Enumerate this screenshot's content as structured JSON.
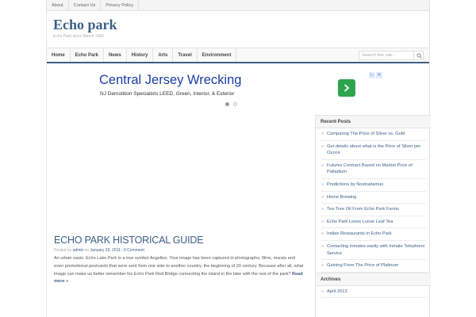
{
  "topbar": {
    "links": [
      "About",
      "Contact Us",
      "Privacy Policy"
    ]
  },
  "site": {
    "title": "Echo park",
    "tagline": "Echo Park since March 1966"
  },
  "nav": {
    "items": [
      "Home",
      "Echo Park",
      "News",
      "History",
      "Arts",
      "Travel",
      "Environment"
    ]
  },
  "search": {
    "placeholder": "Search this site..."
  },
  "ad": {
    "headline": "Central Jersey Wrecking",
    "text": "NJ Demolition Specialists LEED, Green, Interior, & Exterior",
    "choices": [
      "▷",
      "✕"
    ]
  },
  "post": {
    "title": "ECHO PARK HISTORICAL GUIDE",
    "meta_posted_by": "Posted by",
    "meta_author": "admin",
    "meta_on": "on",
    "meta_date": "January 29, 2011",
    "meta_sep": "|",
    "meta_comments": "0 Comment",
    "body": "An urban oasis: Echo Lake Park is a true symbol Angelino. Your image has been captured in photographs, films, murals and even promotional postcards that were sent from one side to another country, the beginning of 20 century. Because after all, what image can make us better remember his Echo Park Red Bridge connecting the island in the lake with the rest of the park?",
    "read_more": "Read more »"
  },
  "sidebar": {
    "recent_title": "Recent Posts",
    "recent": [
      "Comparing The Price of Silver vs. Gold",
      "Get details about what is the Price of Silver per Ounce",
      "Futures Contract Based on Market Price of Palladium",
      "Predictions by Nostradamus",
      "Home Brewing",
      "Tea Tree Oil From Echo Park Farms",
      "Echo Park Loves Loose Leaf Tea",
      "Indian Restaurants in Echo Park",
      "Contacting Inmates easily with Inmate Telephone Service",
      "Gaining From The Price of Platinum"
    ],
    "archives_title": "Archives",
    "archives": [
      "April 2013"
    ]
  },
  "colors": {
    "accent": "#3b5f86",
    "ad_blue": "#1a3ea8",
    "ad_green": "#2ea44f"
  }
}
